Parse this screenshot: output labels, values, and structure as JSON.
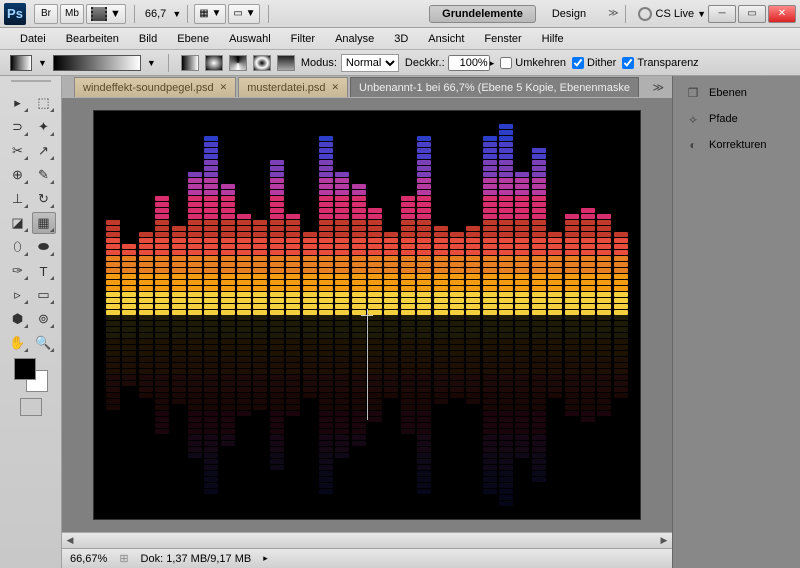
{
  "titlebar": {
    "app": "Ps",
    "br": "Br",
    "mb": "Mb",
    "zoom": "66,7",
    "workspaces": [
      "Grundelemente",
      "Design"
    ],
    "cslive": "CS Live"
  },
  "menu": [
    "Datei",
    "Bearbeiten",
    "Bild",
    "Ebene",
    "Auswahl",
    "Filter",
    "Analyse",
    "3D",
    "Ansicht",
    "Fenster",
    "Hilfe"
  ],
  "optbar": {
    "modus_label": "Modus:",
    "modus_value": "Normal",
    "deckkr_label": "Deckkr.:",
    "deckkr_value": "100%",
    "umkehren": "Umkehren",
    "dither": "Dither",
    "transparenz": "Transparenz"
  },
  "tabs": [
    {
      "label": "windeffekt-soundpegel.psd",
      "active": false
    },
    {
      "label": "musterdatei.psd",
      "active": false
    },
    {
      "label": "Unbenannt-1 bei 66,7% (Ebene 5 Kopie, Ebenenmaske",
      "active": true
    }
  ],
  "panels": [
    {
      "icon": "layers-icon",
      "label": "Ebenen"
    },
    {
      "icon": "paths-icon",
      "label": "Pfade"
    },
    {
      "icon": "adjustments-icon",
      "label": "Korrekturen"
    }
  ],
  "status": {
    "zoom": "66,67%",
    "doc": "Dok: 1,37 MB/9,17 MB"
  },
  "chart_data": {
    "type": "bar",
    "description": "Audio equalizer visualization with color gradient from yellow (bottom) through orange, red, magenta, purple to blue (top)",
    "bars": 32,
    "heights": [
      16,
      12,
      14,
      20,
      15,
      24,
      30,
      22,
      17,
      16,
      26,
      17,
      14,
      30,
      24,
      22,
      18,
      14,
      20,
      30,
      15,
      14,
      15,
      30,
      32,
      24,
      28,
      14,
      17,
      18,
      17,
      14
    ],
    "color_stops": [
      "#f4d03f",
      "#f39c12",
      "#e67e22",
      "#e74c3c",
      "#c0392b",
      "#d82e6e",
      "#b53ba2",
      "#7b3fb8",
      "#4a3fc8",
      "#2c3ec8"
    ]
  }
}
